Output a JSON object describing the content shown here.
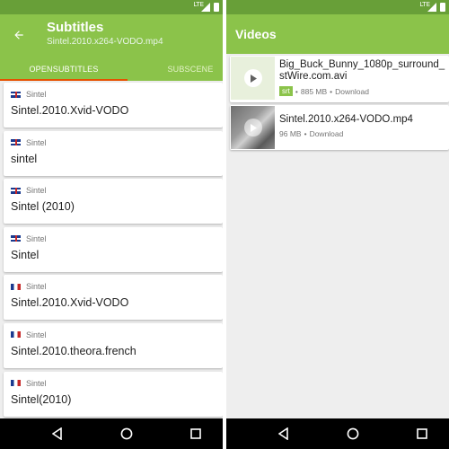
{
  "subtitles": {
    "title": "Subtitles",
    "filename": "Sintel.2010.x264-VODO.mp4",
    "tabs": [
      {
        "label": "OPENSUBTITLES",
        "selected": true
      },
      {
        "label": "SUBSCENE",
        "selected": false
      }
    ],
    "items": [
      {
        "flag": "uk-flag-icon",
        "language": "Sintel",
        "name": "Sintel.2010.Xvid-VODO"
      },
      {
        "flag": "uk-flag-icon",
        "language": "Sintel",
        "name": "sintel"
      },
      {
        "flag": "uk-flag-icon",
        "language": "Sintel",
        "name": "Sintel (2010)"
      },
      {
        "flag": "uk-flag-icon",
        "language": "Sintel",
        "name": "Sintel"
      },
      {
        "flag": "france-flag-icon",
        "language": "Sintel",
        "name": "Sintel.2010.Xvid-VODO"
      },
      {
        "flag": "france-flag-icon",
        "language": "Sintel",
        "name": "Sintel.2010.theora.french"
      },
      {
        "flag": "france-flag-icon",
        "language": "Sintel",
        "name": "Sintel(2010)"
      }
    ]
  },
  "videos": {
    "title": "Videos",
    "items": [
      {
        "name": "Big_Buck_Bunny_1080p_surround_\nstWire.com.avi",
        "badge": "srt",
        "size": "885 MB",
        "separator": "•",
        "action": "Download"
      },
      {
        "name": "Sintel.2010.x264-VODO.mp4",
        "size": "96 MB",
        "separator": "•",
        "action": "Download"
      }
    ]
  },
  "status_icons": {
    "network": "LTE"
  },
  "colors": {
    "primary": "#8bc34a",
    "primary_dark": "#689f38",
    "accent": "#e65100"
  },
  "icons": {
    "back": "arrow-back-icon",
    "play": "play-icon",
    "nav_back": "nav-back-icon",
    "nav_home": "nav-home-icon",
    "nav_recent": "nav-recent-icon"
  }
}
